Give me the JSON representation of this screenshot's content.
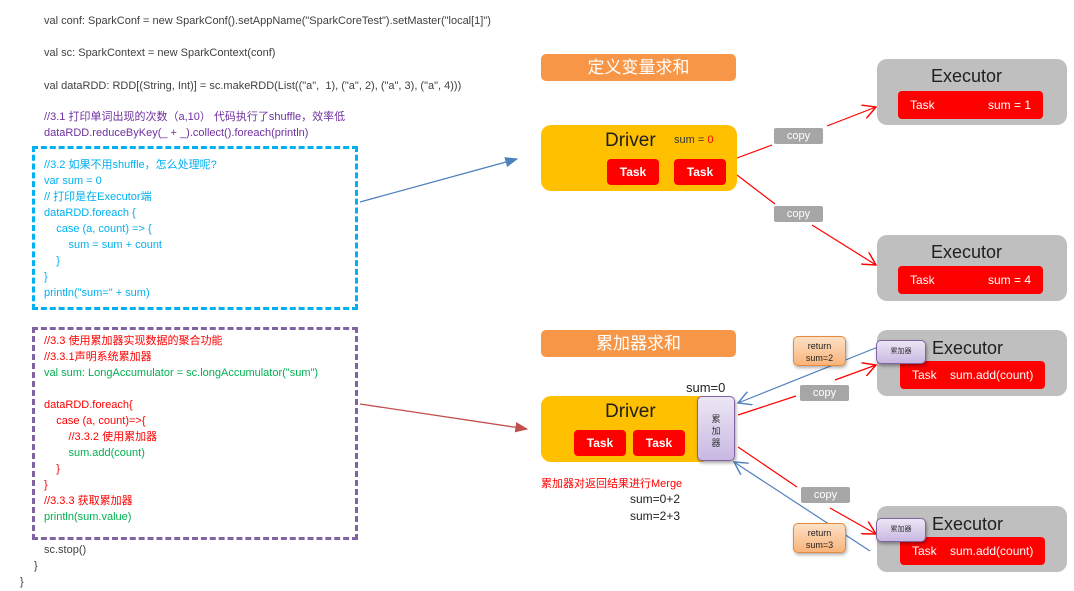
{
  "code": {
    "line_conf": "val conf: SparkConf = new SparkConf().setAppName(\"SparkCoreTest\").setMaster(\"local[1]\")",
    "line_sc": "val sc: SparkContext = new SparkContext(conf)",
    "line_rdd": "val dataRDD: RDD[(String, Int)] = sc.makeRDD(List((\"a\",  1), (\"a\", 2), (\"a\", 3), (\"a\", 4)))",
    "comment_31": "//3.1 打印单词出现的次数（a,10） 代码执行了shuffle，效率低",
    "line_reduce": "dataRDD.reduceByKey(_ + _).collect().foreach(println)",
    "block32": [
      "//3.2 如果不用shuffle，怎么处理呢?",
      "var sum = 0",
      "// 打印是在Executor端",
      "dataRDD.foreach {",
      "    case (a, count) => {",
      "        sum = sum + count",
      "    }",
      "}",
      "println(\"sum=\" + sum)"
    ],
    "block33": [
      {
        "text": "//3.3 使用累加器实现数据的聚合功能",
        "color": "red"
      },
      {
        "text": "//3.3.1声明系统累加器",
        "color": "red"
      },
      {
        "text": "val sum: LongAccumulator = sc.longAccumulator(\"sum\")",
        "color": "green"
      },
      {
        "text": "",
        "color": "red"
      },
      {
        "text": "dataRDD.foreach{",
        "color": "red"
      },
      {
        "text": "    case (a, count)=>{",
        "color": "red"
      },
      {
        "text": "        //3.3.2 使用累加器",
        "color": "red"
      },
      {
        "text": "        sum.add(count)",
        "color": "green"
      },
      {
        "text": "    }",
        "color": "red"
      },
      {
        "text": "}",
        "color": "red"
      },
      {
        "text": "//3.3.3 获取累加器",
        "color": "red"
      },
      {
        "text": "println(sum.value)",
        "color": "green"
      }
    ],
    "line_stop": "sc.stop()",
    "close1": "}",
    "close2": "}"
  },
  "top_diagram": {
    "title": "定义变量求和",
    "driver_label": "Driver",
    "driver_sum_label": "sum = ",
    "driver_sum_value": "0",
    "tasks": [
      "Task",
      "Task"
    ],
    "copy_labels": [
      "copy",
      "copy"
    ],
    "executors": [
      {
        "label": "Executor",
        "task": "Task",
        "sum": "sum = 1"
      },
      {
        "label": "Executor",
        "task": "Task",
        "sum": "sum = 4"
      }
    ]
  },
  "bottom_diagram": {
    "title": "累加器求和",
    "driver_label": "Driver",
    "driver_sum": "sum=0",
    "tasks": [
      "Task",
      "Task"
    ],
    "accumulator_label": "累\n加\n器",
    "merge_note": "累加器对返回结果进行Merge",
    "merge_steps": [
      "sum=0+2",
      "sum=2+3"
    ],
    "copy_labels": [
      "copy",
      "copy"
    ],
    "returns": [
      "return\nsum=2",
      "return\nsum=3"
    ],
    "executors": [
      {
        "label": "Executor",
        "acc": "累加器",
        "task": "Task",
        "op": "sum.add(count)"
      },
      {
        "label": "Executor",
        "acc": "累加器",
        "task": "Task",
        "op": "sum.add(count)"
      }
    ]
  },
  "colors": {
    "title_orange": "#f79646",
    "driver_yellow": "#ffc000",
    "task_red": "#ff0000",
    "executor_gray": "#bfbfbf",
    "copy_gray": "#a6a6a6",
    "cyan_dash": "#00b0f0",
    "purple_dash": "#8064a2",
    "arrow_blue": "#4f81bd",
    "arrow_red": "#ff0000"
  }
}
